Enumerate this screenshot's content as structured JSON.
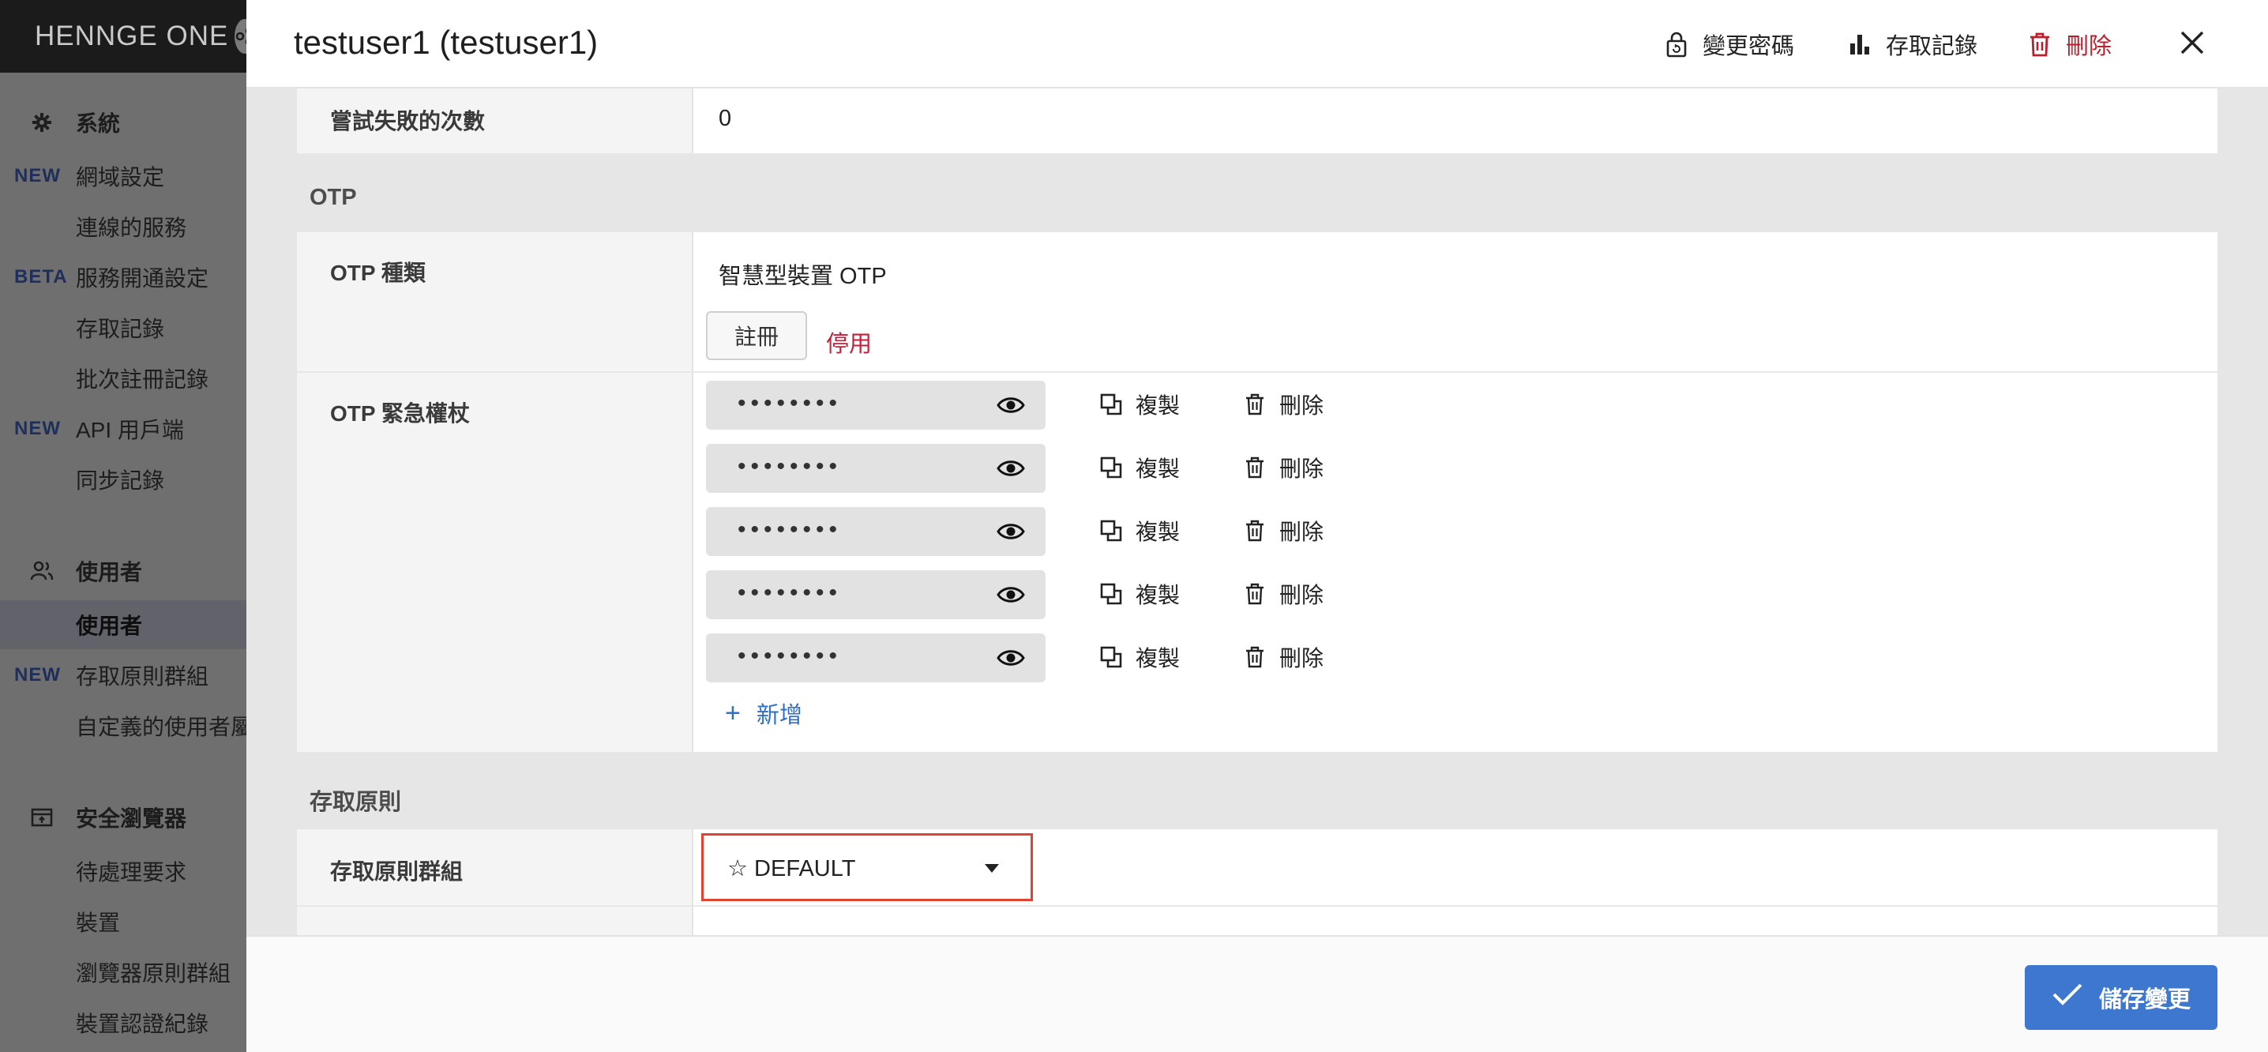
{
  "brand": {
    "name": "HENNGE ONE"
  },
  "sidebar": {
    "sections": [
      {
        "title": "系統",
        "icon": "gear-icon"
      },
      {
        "title": "使用者",
        "icon": "users-icon"
      },
      {
        "title": "安全瀏覽器",
        "icon": "browser-icon"
      }
    ],
    "items": [
      {
        "tag": "NEW",
        "label": "網域設定"
      },
      {
        "tag": "",
        "label": "連線的服務"
      },
      {
        "tag": "BETA",
        "label": "服務開通設定"
      },
      {
        "tag": "",
        "label": "存取記錄"
      },
      {
        "tag": "",
        "label": "批次註冊記錄"
      },
      {
        "tag": "NEW",
        "label": "API 用戶端"
      },
      {
        "tag": "",
        "label": "同步記錄"
      },
      {
        "tag": "",
        "label": "使用者"
      },
      {
        "tag": "NEW",
        "label": "存取原則群組"
      },
      {
        "tag": "",
        "label": "自定義的使用者屬性"
      },
      {
        "tag": "",
        "label": "待處理要求"
      },
      {
        "tag": "",
        "label": "裝置"
      },
      {
        "tag": "",
        "label": "瀏覽器原則群組"
      },
      {
        "tag": "",
        "label": "裝置認證紀錄"
      }
    ]
  },
  "modal": {
    "title": "testuser1 (testuser1)",
    "actions": {
      "change_password": "變更密碼",
      "access_log": "存取記錄",
      "delete": "刪除"
    },
    "failed_attempts": {
      "label": "嘗試失敗的次數",
      "value": "0"
    },
    "otp": {
      "section_title": "OTP",
      "type_label": "OTP 種類",
      "type_value": "智慧型裝置 OTP",
      "register_button": "註冊",
      "disable_link": "停用",
      "emergency_label": "OTP 緊急權杖",
      "tokens": [
        {
          "masked": "••••••••",
          "copy": "複製",
          "delete": "刪除"
        },
        {
          "masked": "••••••••",
          "copy": "複製",
          "delete": "刪除"
        },
        {
          "masked": "••••••••",
          "copy": "複製",
          "delete": "刪除"
        },
        {
          "masked": "••••••••",
          "copy": "複製",
          "delete": "刪除"
        },
        {
          "masked": "••••••••",
          "copy": "複製",
          "delete": "刪除"
        }
      ],
      "add_label": "新增"
    },
    "access_policy": {
      "section_title": "存取原則",
      "group_label": "存取原則群組",
      "group_value": "☆ DEFAULT"
    },
    "save_label": "儲存變更"
  },
  "colors": {
    "accent": "#3d77cf",
    "danger": "#b8202e",
    "highlight_border": "#e0432f"
  }
}
